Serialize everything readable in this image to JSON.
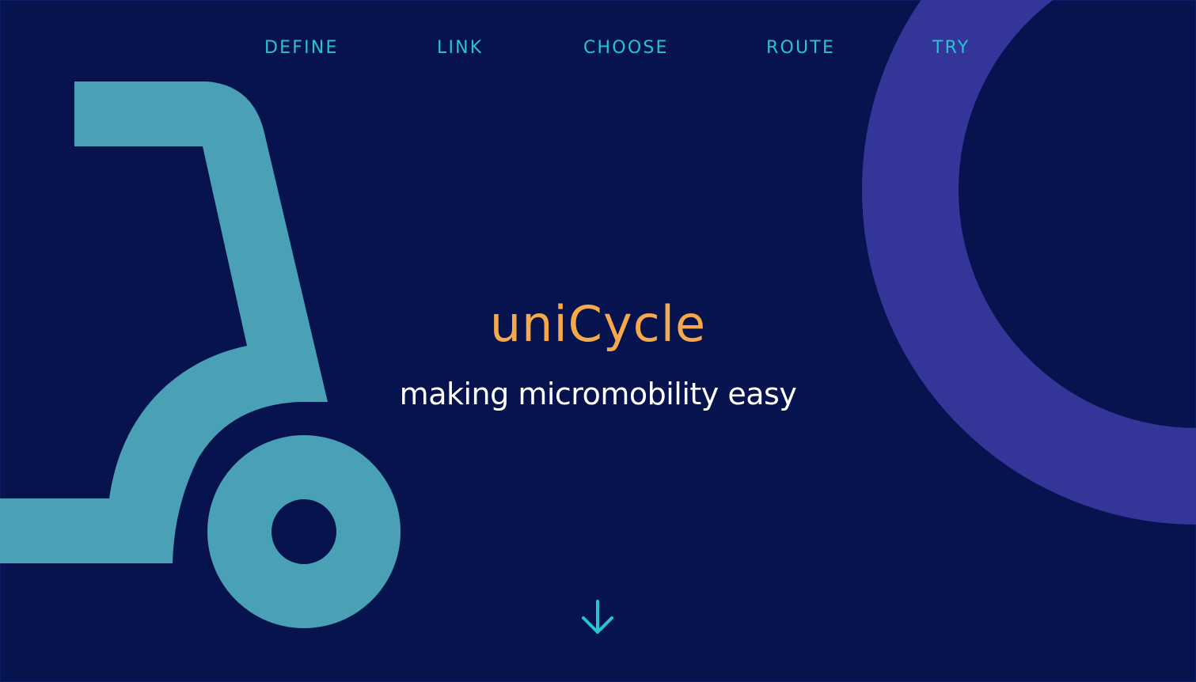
{
  "nav": {
    "items": [
      {
        "label": "DEFINE"
      },
      {
        "label": "LINK"
      },
      {
        "label": "CHOOSE"
      },
      {
        "label": "ROUTE"
      },
      {
        "label": "TRY"
      }
    ]
  },
  "hero": {
    "title": "uniCycle",
    "tagline": "making micromobility easy"
  },
  "icons": {
    "scroll": "arrow-down-icon",
    "left_graphic": "scooter-icon",
    "right_graphic": "ring-graphic"
  },
  "colors": {
    "background": "#06134f",
    "accent_teal": "#29c3cf",
    "scooter": "#4aa0b5",
    "ring": "#333598",
    "title": "#f5a94a",
    "tagline": "#ffffff"
  }
}
